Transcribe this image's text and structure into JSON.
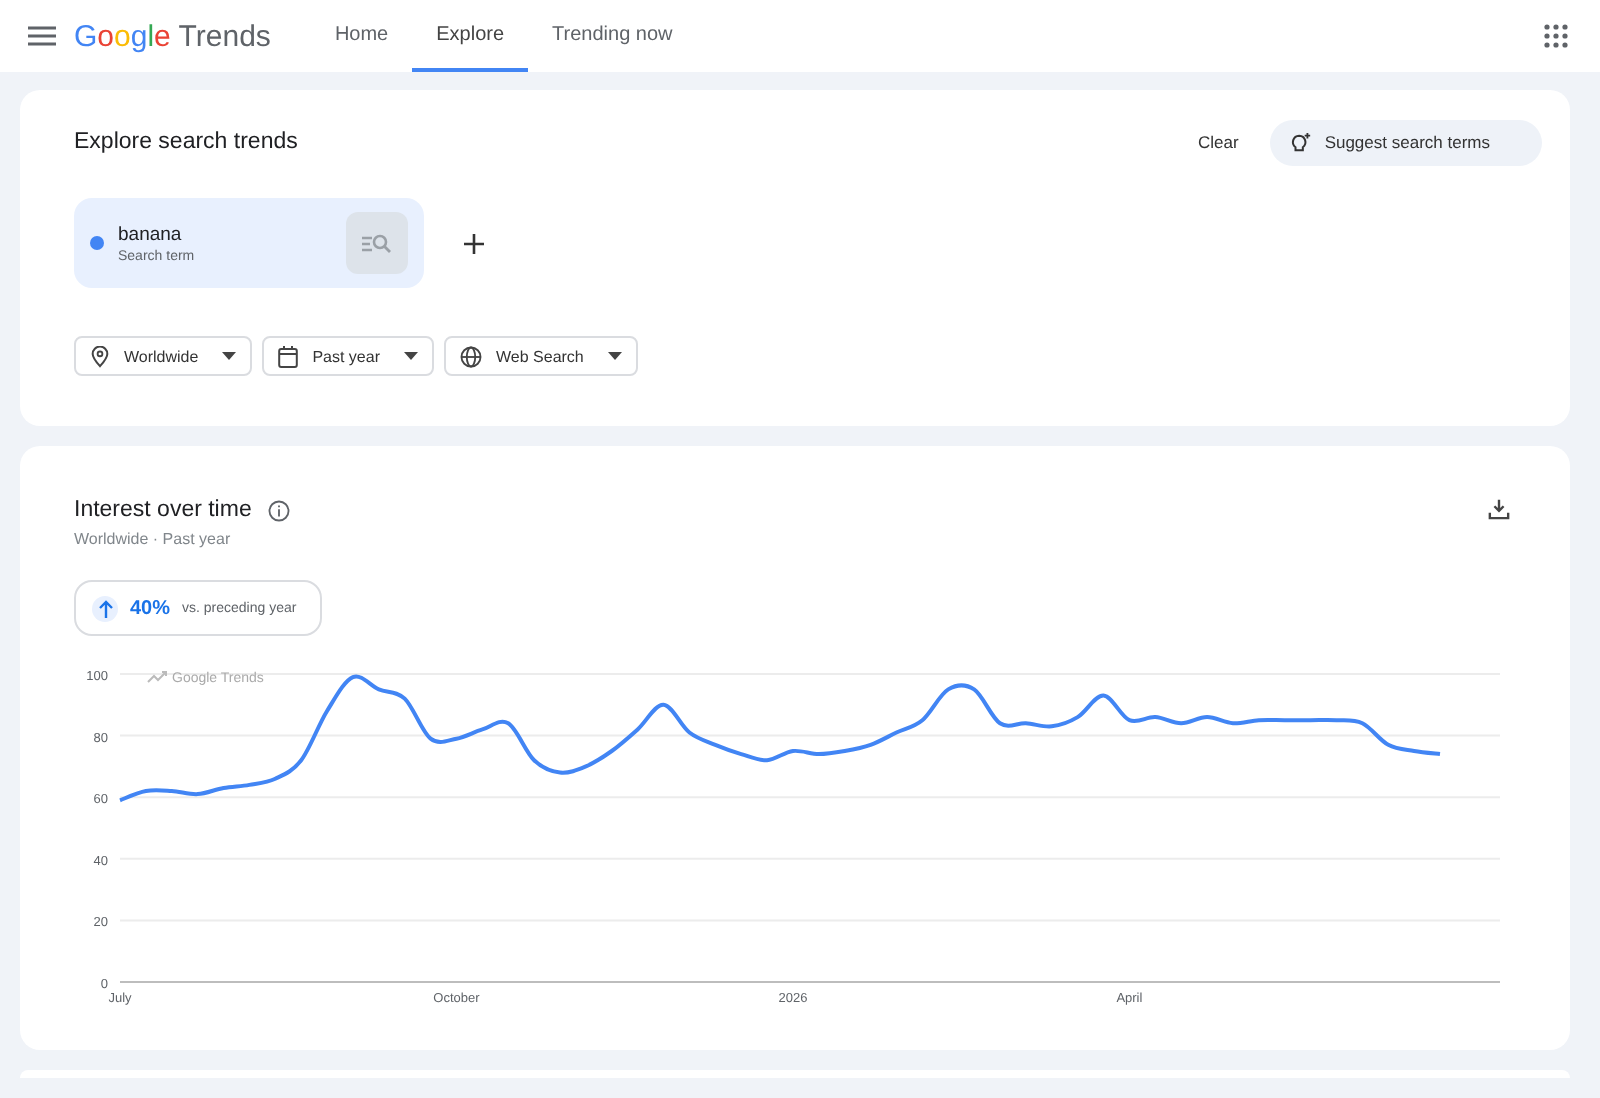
{
  "header": {
    "logo_word": "Google",
    "product": "Trends",
    "nav": [
      {
        "label": "Home",
        "selected": false
      },
      {
        "label": "Explore",
        "selected": true
      },
      {
        "label": "Trending now",
        "selected": false
      }
    ]
  },
  "explore": {
    "title": "Explore search trends",
    "clear": "Clear",
    "suggest": "Suggest search terms",
    "terms": [
      {
        "name": "banana",
        "type_label": "Search term",
        "color": "#4285f4"
      }
    ],
    "filters": [
      {
        "kind": "location",
        "label": "Worldwide"
      },
      {
        "kind": "time",
        "label": "Past year"
      },
      {
        "kind": "property",
        "label": "Web Search"
      }
    ]
  },
  "interest": {
    "title": "Interest over time",
    "subtitle": "Worldwide · Past year",
    "change": {
      "value": "40%",
      "note": "vs. preceding year"
    },
    "brand": "Google Trends",
    "chart_data": {
      "type": "line",
      "grid": true,
      "ylim": [
        0,
        100
      ],
      "yticks": [
        0,
        20,
        40,
        60,
        80,
        100
      ],
      "categories": [
        "July",
        null,
        null,
        null,
        null,
        null,
        null,
        null,
        null,
        null,
        null,
        null,
        null,
        "October",
        null,
        null,
        null,
        null,
        null,
        null,
        null,
        null,
        null,
        null,
        null,
        null,
        "2026",
        null,
        null,
        null,
        null,
        null,
        null,
        null,
        null,
        null,
        null,
        null,
        null,
        "April",
        null,
        null,
        null,
        null,
        null,
        null,
        null,
        null,
        null,
        null,
        null,
        null
      ],
      "series": [
        {
          "color": "#4285f4",
          "values": [
            59,
            62,
            62,
            61,
            63,
            64,
            66,
            72,
            88,
            99,
            95,
            92,
            79,
            79,
            82,
            84,
            72,
            68,
            70,
            75,
            82,
            90,
            81,
            77,
            74,
            72,
            75,
            74,
            75,
            77,
            81,
            85,
            95,
            95,
            84,
            84,
            83,
            86,
            93,
            85,
            86,
            84,
            86,
            84,
            85,
            85,
            85,
            85,
            84,
            77,
            75,
            74
          ]
        }
      ]
    }
  }
}
